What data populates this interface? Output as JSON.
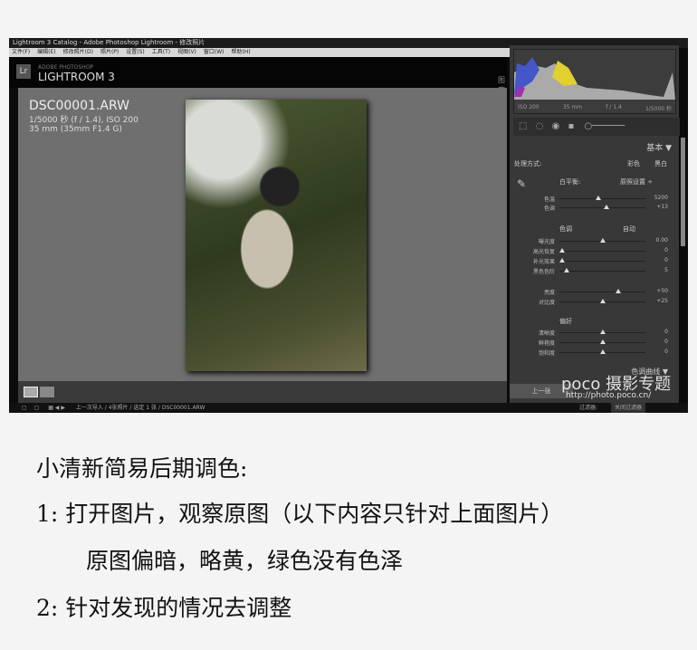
{
  "window_title": "Lightroom 3 Catalog - Adobe Photoshop Lightroom - 修改照片",
  "menu": [
    "文件(F)",
    "编辑(E)",
    "修改照片(D)",
    "照片(P)",
    "设置(S)",
    "工具(T)",
    "视图(V)",
    "窗口(W)",
    "帮助(H)"
  ],
  "brand": {
    "logo": "Lr",
    "line1": "ADOBE PHOTOSHOP",
    "line2": "LIGHTROOM 3",
    "module": "图库"
  },
  "photo_info": {
    "filename": "DSC00001.ARW",
    "exposure": "1/5000 秒 (f / 1.4), ISO 200",
    "lens": "35 mm (35mm F1.4 G)"
  },
  "histogram": {
    "iso": "ISO 200",
    "focal": "35 mm",
    "aperture": "f / 1.4",
    "shutter": "1/5000 秒"
  },
  "panel": {
    "title": "基本",
    "treatment_label": "处理方式:",
    "treatment_color": "彩色",
    "treatment_bw": "黑白",
    "wb_label": "白平衡:",
    "wb_value": "原照设置 ÷",
    "wb_sliders": [
      {
        "label": "色温",
        "value": "5200",
        "pos": 0.45
      },
      {
        "label": "色调",
        "value": "+13",
        "pos": 0.55
      }
    ],
    "tone_label": "色调",
    "tone_auto": "自动",
    "tone_sliders": [
      {
        "label": "曝光度",
        "value": "0.00",
        "pos": 0.5
      },
      {
        "label": "高光恢复",
        "value": "0",
        "pos": 0.03
      },
      {
        "label": "补光效果",
        "value": "0",
        "pos": 0.03
      },
      {
        "label": "黑色色阶",
        "value": "5",
        "pos": 0.08
      }
    ],
    "tone_sliders2": [
      {
        "label": "亮度",
        "value": "+50",
        "pos": 0.68
      },
      {
        "label": "对比度",
        "value": "+25",
        "pos": 0.5
      }
    ],
    "presence_label": "偏好",
    "presence_sliders": [
      {
        "label": "清晰度",
        "value": "0",
        "pos": 0.5
      },
      {
        "label": "鲜艳度",
        "value": "0",
        "pos": 0.5
      },
      {
        "label": "饱和度",
        "value": "0",
        "pos": 0.5
      }
    ],
    "next_section": "色调曲线",
    "prev_button": "上一张",
    "filter_label": "过滤器:",
    "filter_value": "关闭过滤器"
  },
  "filmstrip": {
    "path": "上一次导入 / 4张照片 / 选定 1 张 / DSC00001.ARW"
  },
  "watermark": {
    "brand": "poco 摄影专题",
    "url": "http://photo.poco.cn/"
  },
  "article": {
    "title": "小清新简易后期调色:",
    "step1": "1: 打开图片，观察原图（以下内容只针对上面图片）",
    "step1_note": "原图偏暗，略黄，绿色没有色泽",
    "step2": "2: 针对发现的情况去调整"
  }
}
